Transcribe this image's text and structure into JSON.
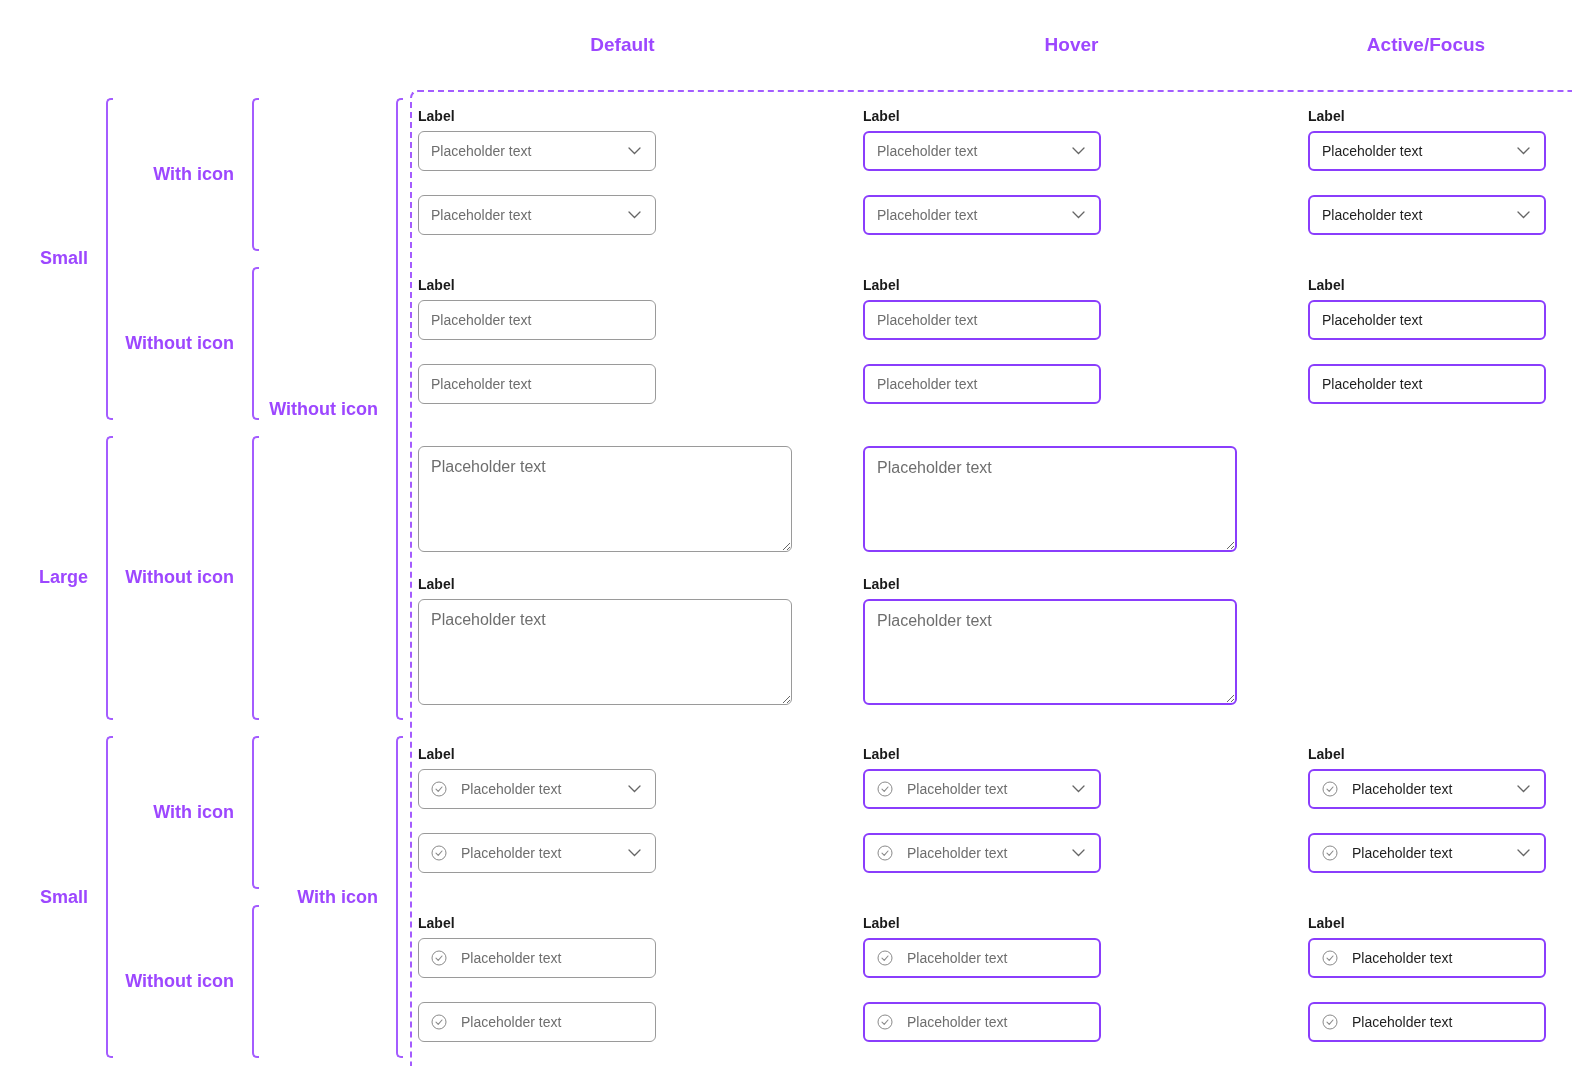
{
  "columns": [
    {
      "title": "Default",
      "kind": "default"
    },
    {
      "title": "Hover",
      "kind": "hover"
    },
    {
      "title": "Active/Focus",
      "kind": "active"
    }
  ],
  "sections": [
    {
      "title": "Without icon",
      "lead_icon": false,
      "groups": [
        {
          "title": "Small",
          "subgroups": [
            {
              "title": "With icon",
              "kind": "select",
              "cells": [
                {
                  "items": [
                    {
                      "label": "Label",
                      "placeholder": "Placeholder text"
                    },
                    {
                      "placeholder": "Placeholder text"
                    }
                  ]
                },
                {
                  "items": [
                    {
                      "label": "Label",
                      "placeholder": "Placeholder text"
                    },
                    {
                      "placeholder": "Placeholder text"
                    }
                  ]
                },
                {
                  "items": [
                    {
                      "label": "Label",
                      "placeholder": "Placeholder text"
                    },
                    {
                      "placeholder": "Placeholder text"
                    }
                  ]
                }
              ]
            },
            {
              "title": "Without icon",
              "kind": "input",
              "cells": [
                {
                  "items": [
                    {
                      "label": "Label",
                      "placeholder": "Placeholder text"
                    },
                    {
                      "placeholder": "Placeholder text"
                    }
                  ]
                },
                {
                  "items": [
                    {
                      "label": "Label",
                      "placeholder": "Placeholder text"
                    },
                    {
                      "placeholder": "Placeholder text"
                    }
                  ]
                },
                {
                  "items": [
                    {
                      "label": "Label",
                      "placeholder": "Placeholder text"
                    },
                    {
                      "placeholder": "Placeholder text"
                    }
                  ]
                }
              ]
            }
          ]
        },
        {
          "title": "Large",
          "subgroups": [
            {
              "title": "Without icon",
              "kind": "textarea",
              "cells": [
                {
                  "items": [
                    {
                      "placeholder": "Placeholder text"
                    },
                    {
                      "label": "Label",
                      "placeholder": "Placeholder text"
                    }
                  ]
                },
                {
                  "items": [
                    {
                      "placeholder": "Placeholder text"
                    },
                    {
                      "label": "Label",
                      "placeholder": "Placeholder text"
                    }
                  ]
                }
              ]
            }
          ]
        }
      ]
    },
    {
      "title": "With icon",
      "lead_icon": true,
      "groups": [
        {
          "title": "Small",
          "subgroups": [
            {
              "title": "With icon",
              "kind": "select",
              "cells": [
                {
                  "items": [
                    {
                      "label": "Label",
                      "placeholder": "Placeholder text"
                    },
                    {
                      "placeholder": "Placeholder text"
                    }
                  ]
                },
                {
                  "items": [
                    {
                      "label": "Label",
                      "placeholder": "Placeholder text"
                    },
                    {
                      "placeholder": "Placeholder text"
                    }
                  ]
                },
                {
                  "items": [
                    {
                      "label": "Label",
                      "placeholder": "Placeholder text"
                    },
                    {
                      "placeholder": "Placeholder text"
                    }
                  ]
                }
              ]
            },
            {
              "title": "Without icon",
              "kind": "input",
              "cells": [
                {
                  "items": [
                    {
                      "label": "Label",
                      "placeholder": "Placeholder text"
                    },
                    {
                      "placeholder": "Placeholder text"
                    }
                  ]
                },
                {
                  "items": [
                    {
                      "label": "Label",
                      "placeholder": "Placeholder text"
                    },
                    {
                      "placeholder": "Placeholder text"
                    }
                  ]
                },
                {
                  "items": [
                    {
                      "label": "Label",
                      "placeholder": "Placeholder text"
                    },
                    {
                      "placeholder": "Placeholder text"
                    }
                  ]
                }
              ]
            }
          ]
        }
      ]
    }
  ]
}
